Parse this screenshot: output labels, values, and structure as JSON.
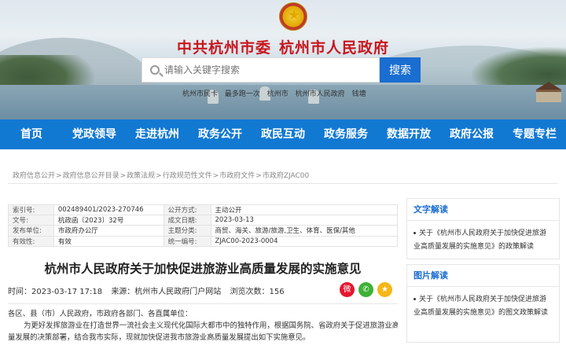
{
  "header": {
    "org_party": "中共杭州市委",
    "org_gov": "杭州市人民政府",
    "search_placeholder": "请输入关键字搜索",
    "search_button": "搜索",
    "hot_words": [
      "杭州市民卡",
      "最多跑一次",
      "杭州市",
      "杭州市人民政府",
      "钱塘"
    ]
  },
  "nav": {
    "items": [
      "首页",
      "党政领导",
      "走进杭州",
      "政务公开",
      "政民互动",
      "政务服务",
      "数据开放",
      "政府公报",
      "专题专栏"
    ]
  },
  "breadcrumb": [
    "政府信息公开",
    "政府信息公开目录",
    "政策法规",
    "行政规范性文件",
    "市政府文件",
    "市政府ZJAC00"
  ],
  "info_table": {
    "rows": [
      [
        "索引号:",
        "002489401/2023-270746",
        "公开方式:",
        "主动公开"
      ],
      [
        "文号:",
        "杭政函〔2023〕32号",
        "成文日期:",
        "2023-03-13"
      ],
      [
        "发布单位:",
        "市政府办公厅",
        "主题分类:",
        "商贸、海关、旅游/旅游,卫生、体育、医保/其他"
      ],
      [
        "有效性:",
        "有效",
        "统一编号:",
        "ZJAC00-2023-0004"
      ]
    ]
  },
  "article": {
    "title": "杭州市人民政府关于加快促进旅游业高质量发展的实施意见",
    "time": "时间：2023-03-17 17:18",
    "source": "来源：杭州市人民政府门户网站",
    "views": "浏览次数：156",
    "para1": "各区、县（市）人民政府，市政府各部门、各直属单位：",
    "para2": "为更好发挥旅游业在打造世界一流社会主义现代化国际大都市中的独特作用，根据国务院、省政府关于促进旅游业高质",
    "para3": "量发展的决策部署，结合我市实际，现就加快促进我市旅游业高质量发展提出如下实施意见。"
  },
  "sidebar": {
    "text_interp": {
      "title": "文字解读",
      "item": "关于《杭州市人民政府关于加快促进旅游业高质量发展的实施意见》的政策解读"
    },
    "image_interp": {
      "title": "图片解读",
      "item": "关于《杭州市人民政府关于加快促进旅游业高质量发展的实施意见》的图文政策解读"
    }
  },
  "icons": {
    "emblem": "national-emblem",
    "search": "search-icon",
    "share": [
      "weibo-icon",
      "wechat-icon",
      "qzone-icon"
    ]
  },
  "colors": {
    "brand_red": "#c8161d",
    "nav_blue": "#1279d3",
    "accent_blue": "#1a6ed1"
  }
}
